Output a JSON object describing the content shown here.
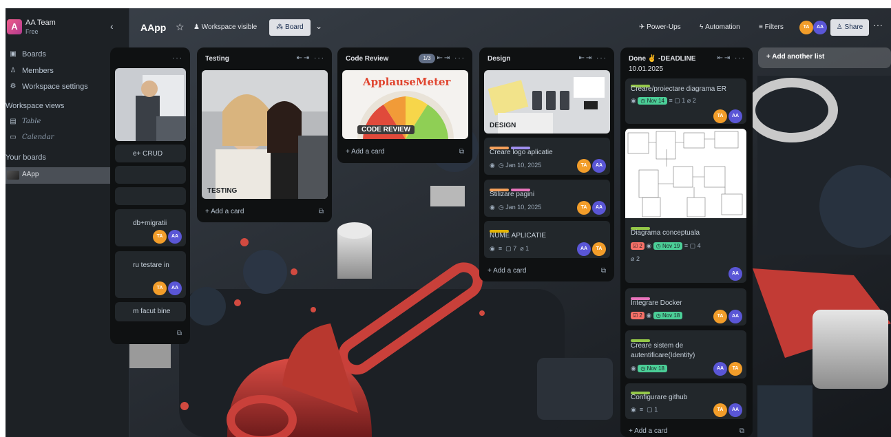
{
  "workspace": {
    "initial": "A",
    "name": "AA Team",
    "plan": "Free"
  },
  "sidebar": {
    "items": [
      {
        "label": "Boards"
      },
      {
        "label": "Members"
      },
      {
        "label": "Workspace settings"
      }
    ],
    "views_heading": "Workspace views",
    "views": [
      {
        "label": "Table"
      },
      {
        "label": "Calendar"
      }
    ],
    "your_boards_heading": "Your boards",
    "boards": [
      {
        "label": "AApp"
      }
    ]
  },
  "topbar": {
    "board_title": "AApp",
    "visibility": "Workspace visible",
    "view_button": "Board",
    "power_ups": "Power-Ups",
    "automation": "Automation",
    "filters": "Filters",
    "share": "Share",
    "members": [
      "TA",
      "AA"
    ]
  },
  "lists": {
    "partial": {
      "cards": [
        {
          "text": "e+ CRUD"
        },
        {
          "text": ""
        },
        {
          "text": ""
        },
        {
          "text": "db+migratii"
        },
        {
          "text": "ru testare in"
        },
        {
          "text": "m facut bine"
        }
      ],
      "more": "···"
    },
    "testing": {
      "title": "Testing",
      "cover_caption": "TESTING",
      "add_card": "+ Add a card"
    },
    "code_review": {
      "title": "Code Review",
      "count": "1/3",
      "cover_brand": "ApplauseMeter",
      "cover_caption": "CODE REVIEW",
      "add_card": "+ Add a card"
    },
    "design": {
      "title": "Design",
      "cover_caption": "DESIGN",
      "cards": [
        {
          "text": "Creare logo aplicatie",
          "date": "Jan 10, 2025"
        },
        {
          "text": "Stilizare pagini",
          "date": "Jan 10, 2025"
        },
        {
          "text": "NUME APLICATIE",
          "comments": "7",
          "attachments": "1"
        }
      ],
      "add_card": "+ Add a card"
    },
    "done": {
      "title_line1": "Done ✌ -DEADLINE",
      "title_line2": "10.01.2025",
      "cards": [
        {
          "text": "Creare/proiectare diagrama ER",
          "date": "Nov 14",
          "comments": "1",
          "attachments": "2"
        },
        {
          "text": "Diagrama conceptuala",
          "checklist": "2",
          "date": "Nov 19",
          "comments": "4",
          "attachments": "2"
        },
        {
          "text": "Integrare Docker",
          "checklist": "2",
          "date": "Nov 18"
        },
        {
          "text": "Creare sistem de autentificare(Identity)",
          "date": "Nov 18"
        },
        {
          "text": "Configurare github",
          "comments": "1"
        }
      ],
      "add_card": "+ Add a card"
    }
  },
  "add_list": "+ Add another list",
  "colors": {
    "label_orange": "#f5a05a",
    "label_purple": "#9f8fef",
    "label_pink": "#e774bb",
    "label_yellow": "#e2b203",
    "label_green": "#94c748",
    "badge_green": "#4bce97",
    "badge_red": "#f87168",
    "avatar_ta": "#f29d2a",
    "avatar_aa": "#5a56d6"
  }
}
